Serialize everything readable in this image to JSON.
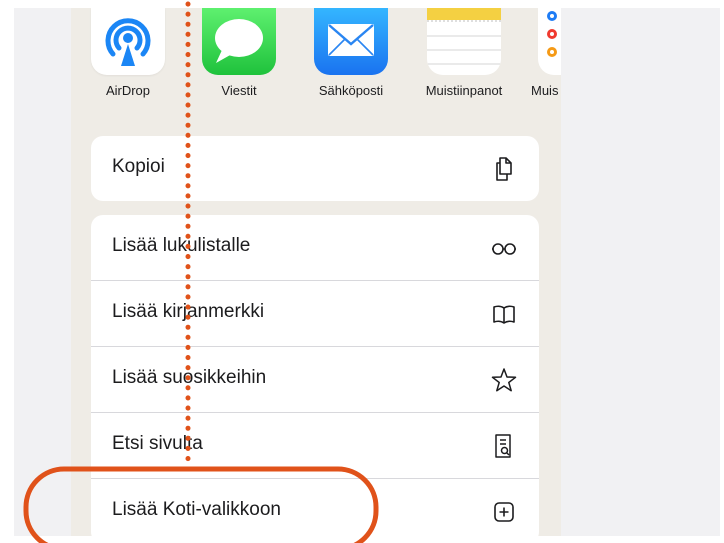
{
  "share_sheet": {
    "apps": [
      {
        "label": "AirDrop",
        "icon": "airdrop-icon"
      },
      {
        "label": "Viestit",
        "icon": "messages-icon"
      },
      {
        "label": "Sähköposti",
        "icon": "mail-icon"
      },
      {
        "label": "Muistiinpanot",
        "icon": "notes-icon"
      },
      {
        "label": "Muis",
        "icon": "reminders-icon"
      }
    ],
    "copy_action": {
      "label": "Kopioi",
      "icon": "copy-icon"
    },
    "actions": [
      {
        "label": "Lisää lukulistalle",
        "icon": "glasses-icon"
      },
      {
        "label": "Lisää kirjanmerkki",
        "icon": "book-icon"
      },
      {
        "label": "Lisää suosikkeihin",
        "icon": "star-icon"
      },
      {
        "label": "Etsi sivulta",
        "icon": "find-in-page-icon"
      },
      {
        "label": "Lisää Koti-valikkoon",
        "icon": "add-square-icon"
      }
    ]
  },
  "colors": {
    "annotation": "#e0521a",
    "sheet_background": "#efece6",
    "messages_green": "#27c843",
    "mail_blue": "#1f8df7",
    "airdrop_blue": "#1b86f5"
  }
}
